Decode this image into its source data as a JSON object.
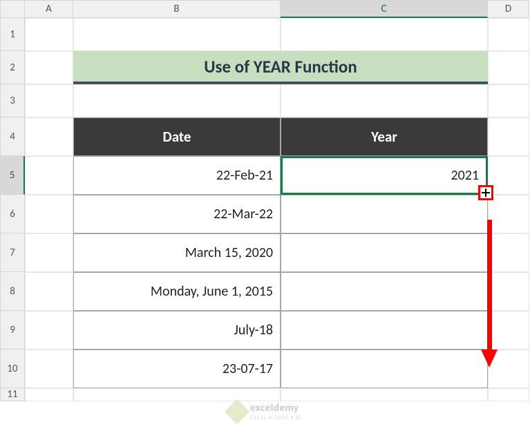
{
  "columns": [
    "A",
    "B",
    "C",
    "D"
  ],
  "rows": [
    "1",
    "2",
    "3",
    "4",
    "5",
    "6",
    "7",
    "8",
    "9",
    "10",
    "11"
  ],
  "title": "Use of YEAR Function",
  "headers": {
    "date": "Date",
    "year": "Year"
  },
  "dates": [
    "22-Feb-21",
    "22-Mar-22",
    "March 15, 2020",
    "Monday, June 1, 2015",
    "July-18",
    "23-07-17"
  ],
  "years": [
    "2021",
    "",
    "",
    "",
    "",
    ""
  ],
  "selected": {
    "row": "5",
    "col": "C"
  },
  "watermark": {
    "name": "exceldemy",
    "tagline": "EXCEL • DATA • BI"
  }
}
